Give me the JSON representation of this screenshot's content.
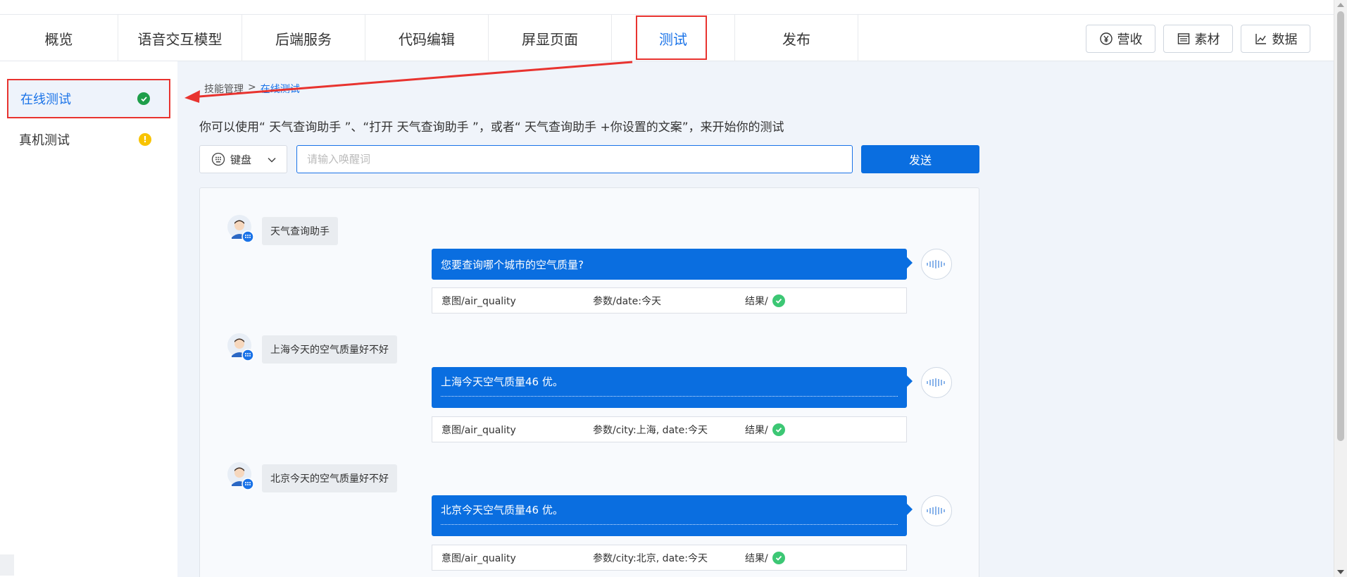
{
  "nav": {
    "tabs": [
      {
        "label": "概览"
      },
      {
        "label": "语音交互模型"
      },
      {
        "label": "后端服务"
      },
      {
        "label": "代码编辑"
      },
      {
        "label": "屏显页面"
      },
      {
        "label": "测试",
        "active": true
      },
      {
        "label": "发布"
      }
    ],
    "tools": [
      {
        "label": "营收",
        "icon": "yen-circle-icon"
      },
      {
        "label": "素材",
        "icon": "materials-icon"
      },
      {
        "label": "数据",
        "icon": "line-chart-icon"
      }
    ]
  },
  "sidebar": {
    "items": [
      {
        "label": "在线测试",
        "status": "ok",
        "status_color": "#1e9e4a",
        "active": true
      },
      {
        "label": "真机测试",
        "status": "warn",
        "status_color": "#f8c300",
        "status_glyph": "!"
      }
    ]
  },
  "breadcrumb": {
    "parent": "技能管理",
    "separator": ">",
    "current": "在线测试"
  },
  "hint": "你可以使用“ 天气查询助手 ”、“打开 天气查询助手 ”，或者“ 天气查询助手 +你设置的文案”，来开始你的测试",
  "input_bar": {
    "mode_label": "键盘",
    "placeholder": "请输入唤醒词",
    "value": "",
    "send_label": "发送"
  },
  "conversation": [
    {
      "user_text": "天气查询助手",
      "bot_text": "您要查询哪个城市的空气质量?",
      "intent": "意图/air_quality",
      "params": "参数/date:今天",
      "result_label": "结果/",
      "result": "ok"
    },
    {
      "user_text": "上海今天的空气质量好不好",
      "bot_text": "上海今天空气质量46 优。",
      "intent": "意图/air_quality",
      "params": "参数/city:上海, date:今天",
      "result_label": "结果/",
      "result": "ok"
    },
    {
      "user_text": "北京今天的空气质量好不好",
      "bot_text": "北京今天空气质量46 优。",
      "intent": "意图/air_quality",
      "params": "参数/city:北京, date:今天",
      "result_label": "结果/",
      "result": "ok"
    }
  ],
  "colors": {
    "accent": "#1a73e8",
    "primary_button": "#0a6ee0",
    "annotation_red": "#e8332f",
    "result_ok": "#3cc774"
  }
}
